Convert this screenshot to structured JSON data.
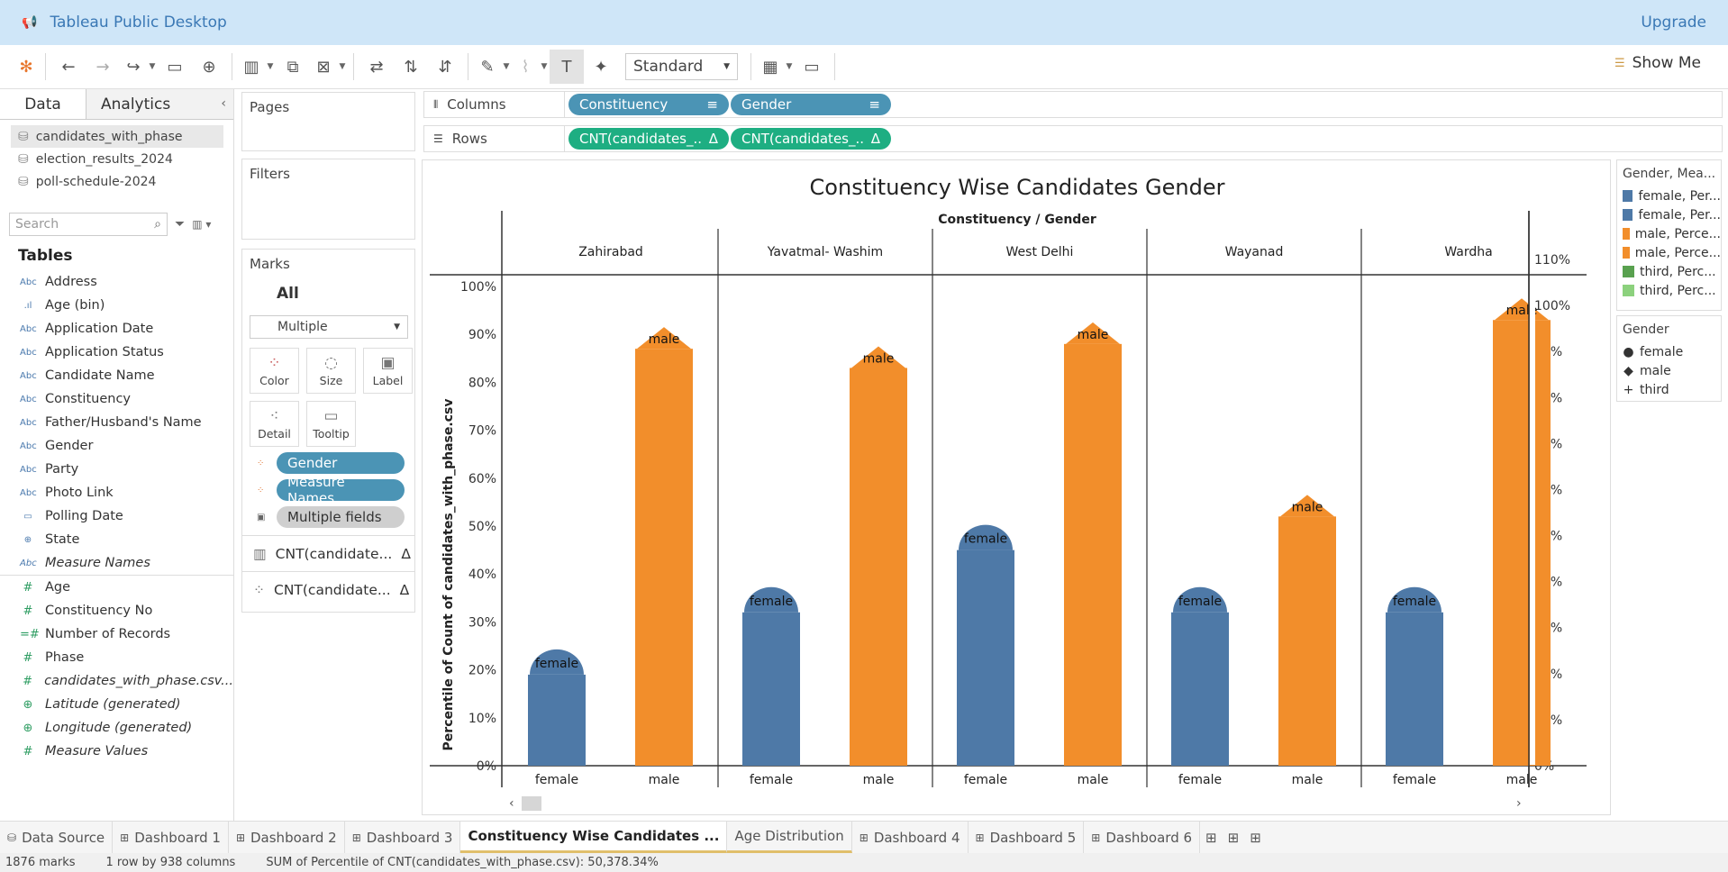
{
  "app": {
    "title": "Tableau Public Desktop",
    "upgrade": "Upgrade"
  },
  "toolbar": {
    "view_mode": "Standard",
    "show_me": "Show Me"
  },
  "data_pane": {
    "tab_data": "Data",
    "tab_analytics": "Analytics",
    "sources": [
      "candidates_with_phase",
      "election_results_2024",
      "poll-schedule-2024"
    ],
    "search_placeholder": "Search",
    "tables_heading": "Tables",
    "dimensions": [
      "Address",
      "Age (bin)",
      "Application Date",
      "Application Status",
      "Candidate Name",
      "Constituency",
      "Father/Husband's Name",
      "Gender",
      "Party",
      "Photo Link",
      "Polling Date",
      "State",
      "Measure Names"
    ],
    "measures": [
      "Age",
      "Constituency No",
      "Number of Records",
      "Phase",
      "candidates_with_phase.csv...",
      "Latitude (generated)",
      "Longitude (generated)",
      "Measure Values"
    ]
  },
  "shelves": {
    "pages": "Pages",
    "filters": "Filters",
    "marks": "Marks",
    "marks_all": "All",
    "marks_type": "Multiple",
    "cards": [
      "Color",
      "Size",
      "Label",
      "Detail",
      "Tooltip"
    ],
    "mark_pills": [
      "Gender",
      "Measure Names",
      "Multiple fields"
    ],
    "mark_rows": [
      "CNT(candidate...",
      "CNT(candidate..."
    ],
    "columns_label": "Columns",
    "rows_label": "Rows",
    "column_pills": [
      "Constituency",
      "Gender"
    ],
    "row_pills": [
      "CNT(candidates_..",
      "CNT(candidates_.."
    ]
  },
  "chart_data": {
    "type": "bar",
    "title": "Constituency  Wise Candidates Gender",
    "header": "Constituency / Gender",
    "ylabel": "Percentile of Count of candidates_with_phase.csv",
    "ylim_left": [
      0,
      100
    ],
    "ylim_right": [
      0,
      110
    ],
    "left_ticks": [
      "0%",
      "10%",
      "20%",
      "30%",
      "40%",
      "50%",
      "60%",
      "70%",
      "80%",
      "90%",
      "100%"
    ],
    "right_ticks": [
      "0%",
      "10%",
      "20%",
      "30%",
      "40%",
      "50%",
      "60%",
      "70%",
      "80%",
      "90%",
      "100%",
      "110%"
    ],
    "categories": [
      "Zahirabad",
      "Yavatmal- Washim",
      "West Delhi",
      "Wayanad",
      "Wardha"
    ],
    "sub_categories": [
      "female",
      "male"
    ],
    "series": [
      {
        "name": "female",
        "values": [
          19,
          32,
          45,
          32,
          32
        ],
        "color": "#4e79a7"
      },
      {
        "name": "male",
        "values": [
          87,
          83,
          88,
          52,
          93
        ],
        "color": "#f28e2b"
      }
    ]
  },
  "legend_color": {
    "title": "Gender, Mea...",
    "items": [
      {
        "label": "female, Per...",
        "color": "#4e79a7"
      },
      {
        "label": "female, Per...",
        "color": "#4e79a7"
      },
      {
        "label": "male, Perce...",
        "color": "#f28e2b"
      },
      {
        "label": "male, Perce...",
        "color": "#f28e2b"
      },
      {
        "label": "third, Perc...",
        "color": "#59a14f"
      },
      {
        "label": "third, Perc...",
        "color": "#8cd17d"
      }
    ]
  },
  "legend_shape": {
    "title": "Gender",
    "items": [
      {
        "label": "female",
        "glyph": "●"
      },
      {
        "label": "male",
        "glyph": "◆"
      },
      {
        "label": "third",
        "glyph": "+"
      }
    ]
  },
  "sheet_tabs": [
    "Data Source",
    "Dashboard 1",
    "Dashboard 2",
    "Dashboard 3",
    "Constituency Wise Candidates ...",
    "Age Distribution",
    "Dashboard 4",
    "Dashboard 5",
    "Dashboard 6"
  ],
  "status": {
    "marks": "1876 marks",
    "dims": "1 row by 938 columns",
    "sum": "SUM of Percentile of CNT(candidates_with_phase.csv): 50,378.34%"
  }
}
